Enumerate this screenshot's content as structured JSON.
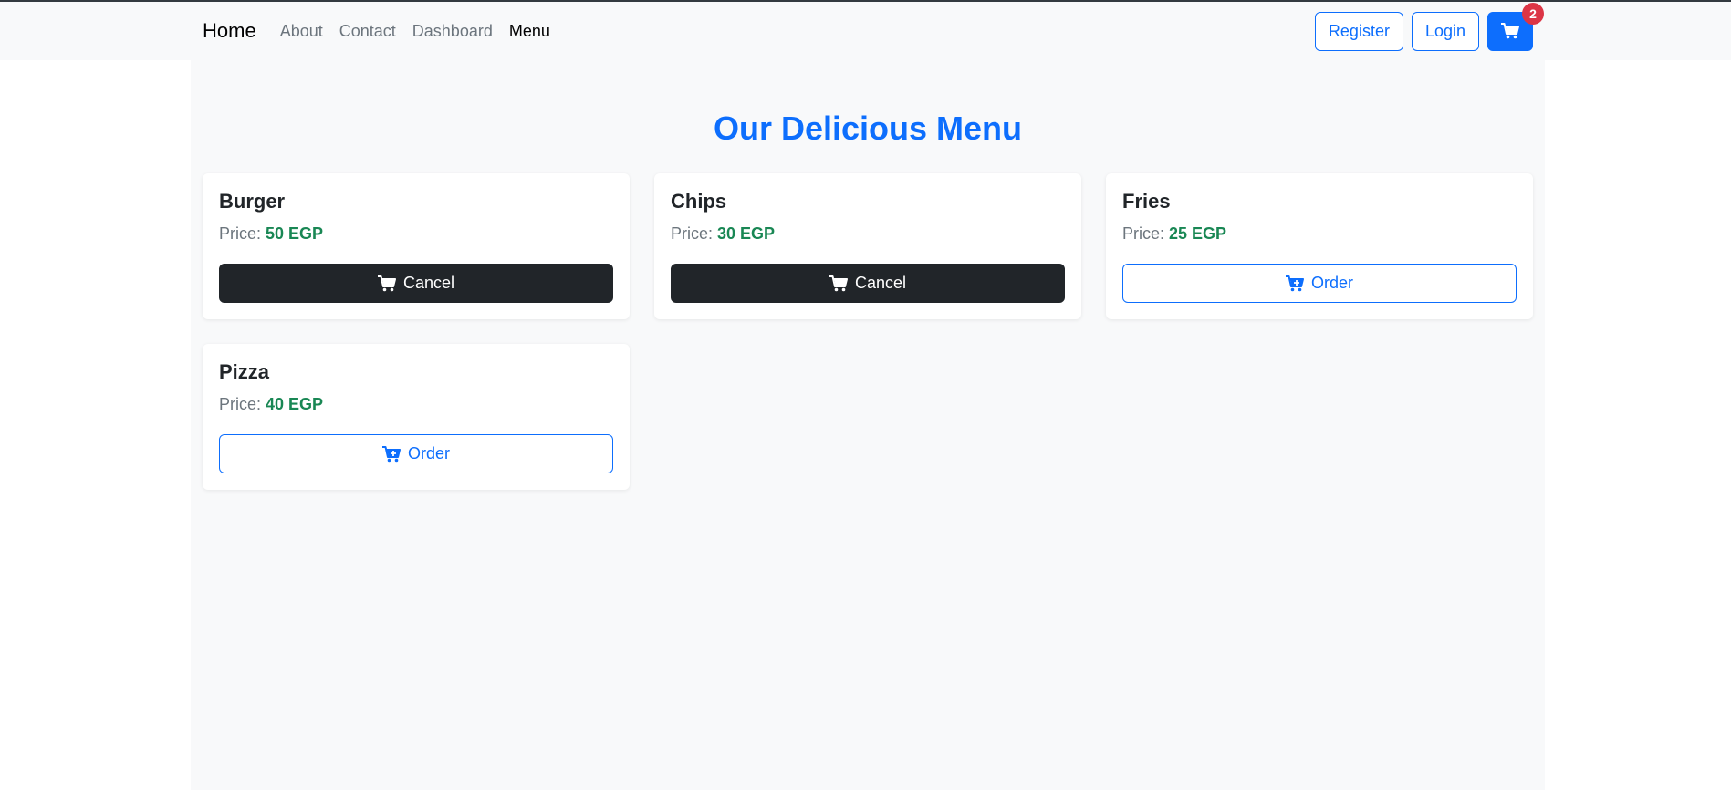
{
  "navbar": {
    "brand": "Home",
    "links": [
      {
        "label": "About"
      },
      {
        "label": "Contact"
      },
      {
        "label": "Dashboard"
      },
      {
        "label": "Menu",
        "active": true
      }
    ],
    "register_label": "Register",
    "login_label": "Login",
    "cart_icon": "cart-icon",
    "cart_count": "2"
  },
  "main": {
    "title": "Our Delicious Menu",
    "price_prefix": "Price:",
    "items": [
      {
        "name": "Burger",
        "price": "50 EGP",
        "action": "Cancel",
        "action_icon": "cart-icon",
        "ordered": true
      },
      {
        "name": "Chips",
        "price": "30 EGP",
        "action": "Cancel",
        "action_icon": "cart-icon",
        "ordered": true
      },
      {
        "name": "Fries",
        "price": "25 EGP",
        "action": "Order",
        "action_icon": "cart-plus-icon",
        "ordered": false
      },
      {
        "name": "Pizza",
        "price": "40 EGP",
        "action": "Order",
        "action_icon": "cart-plus-icon",
        "ordered": false
      }
    ]
  },
  "colors": {
    "primary": "#0d6efd",
    "dark": "#212529",
    "success": "#198754",
    "danger": "#dc3545",
    "muted": "#6c757d",
    "light_bg": "#f8f9fa"
  }
}
